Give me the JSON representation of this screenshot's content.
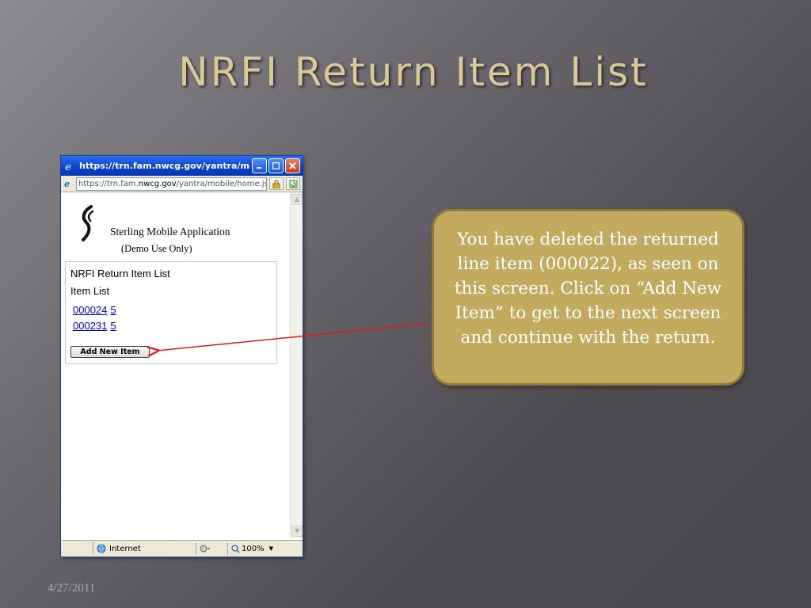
{
  "slide": {
    "title": "NRFI Return Item List",
    "date": "4/27/2011",
    "callout": "You have deleted the returned line item (000022), as seen on this screen. Click on “Add New Item” to get to the next screen and continue with the return."
  },
  "browser": {
    "window_title": "https://trn.fam.nwcg.gov/yantra/mob…",
    "address_prefix": "https://trn.fam.",
    "address_domain": "nwcg.gov",
    "address_suffix": "/yantra/mobile/home.jsp",
    "status_zone": "Internet",
    "zoom": "100%",
    "icons": [
      "ie-icon",
      "minimize-icon",
      "maximize-icon",
      "close-icon",
      "lock-icon",
      "refresh-icon",
      "globe-icon",
      "protected-mode-icon",
      "zoom-icon"
    ]
  },
  "app": {
    "name": "Sterling Mobile Application",
    "subtitle": "(Demo Use Only)",
    "panel_title": "NRFI Return Item List",
    "list_title": "Item List",
    "items": [
      {
        "id": "000024",
        "qty": "5"
      },
      {
        "id": "000231",
        "qty": "5"
      }
    ],
    "add_button": "Add New Item"
  },
  "colors": {
    "callout_bg": "#c2ab5e",
    "title_color": "#d9c99a",
    "arrow": "#e0191c"
  }
}
